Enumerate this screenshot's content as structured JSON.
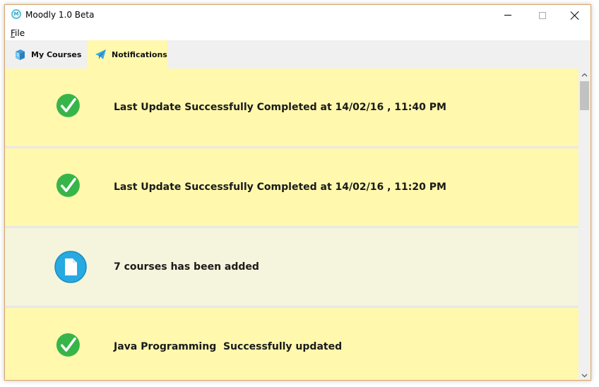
{
  "window": {
    "title": "Moodly 1.0 Beta",
    "app_icon_letter": "M"
  },
  "menu": {
    "file_label": "File"
  },
  "tabs": [
    {
      "label": "My Courses",
      "icon": "books-icon",
      "active": false
    },
    {
      "label": "Notifications",
      "icon": "paper-plane-icon",
      "active": true
    }
  ],
  "notifications": [
    {
      "icon": "checkmark-icon",
      "message": "Last Update Successfully Completed at 14/02/16 , 11:40 PM",
      "background": "#fff8ad"
    },
    {
      "icon": "checkmark-icon",
      "message": "Last Update Successfully Completed at 14/02/16 , 11:20 PM",
      "background": "#fff8ad"
    },
    {
      "icon": "document-icon",
      "message": "7 courses has been added",
      "background": "#f5f4dc"
    },
    {
      "icon": "checkmark-icon",
      "message": "Java Programming  Successfully updated",
      "background": "#fff8ad"
    }
  ],
  "colors": {
    "success_green": "#38b54a",
    "info_blue": "#27a9e1",
    "highlight_yellow": "#fff8ad",
    "info_background": "#f5f4dc"
  }
}
